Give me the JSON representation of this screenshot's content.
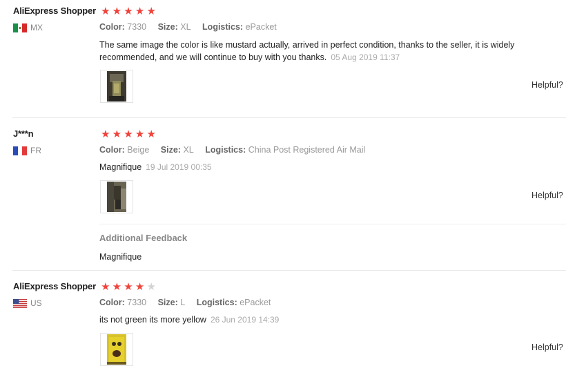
{
  "helpful_label": "Helpful?",
  "colors": {
    "star_on": "#f0433c",
    "star_off": "#d2d2d2"
  },
  "reviews": [
    {
      "user": "AliExpress Shopper",
      "country": "MX",
      "flag_icon": "mexico-flag-icon",
      "rating": 5,
      "attrs": {
        "color_label": "Color:",
        "color": "7330",
        "size_label": "Size:",
        "size": "XL",
        "logistics_label": "Logistics:",
        "logistics": "ePacket"
      },
      "text": "The same image the color is like mustard actually, arrived in perfect condition, thanks to the seller, it is widely recommended, and we will continue to buy with you thanks.",
      "date": "05 Aug 2019 11:37"
    },
    {
      "user": "J***n",
      "country": "FR",
      "flag_icon": "france-flag-icon",
      "rating": 5,
      "attrs": {
        "color_label": "Color:",
        "color": "Beige",
        "size_label": "Size:",
        "size": "XL",
        "logistics_label": "Logistics:",
        "logistics": "China Post Registered Air Mail"
      },
      "text": "Magnifique",
      "date": "19 Jul 2019 00:35",
      "additional_title": "Additional Feedback",
      "additional_text": "Magnifique"
    },
    {
      "user": "AliExpress Shopper",
      "country": "US",
      "flag_icon": "usa-flag-icon",
      "rating": 4,
      "attrs": {
        "color_label": "Color:",
        "color": "7330",
        "size_label": "Size:",
        "size": "L",
        "logistics_label": "Logistics:",
        "logistics": "ePacket"
      },
      "text": "its not green its more yellow",
      "date": "26 Jun 2019 14:39"
    }
  ]
}
